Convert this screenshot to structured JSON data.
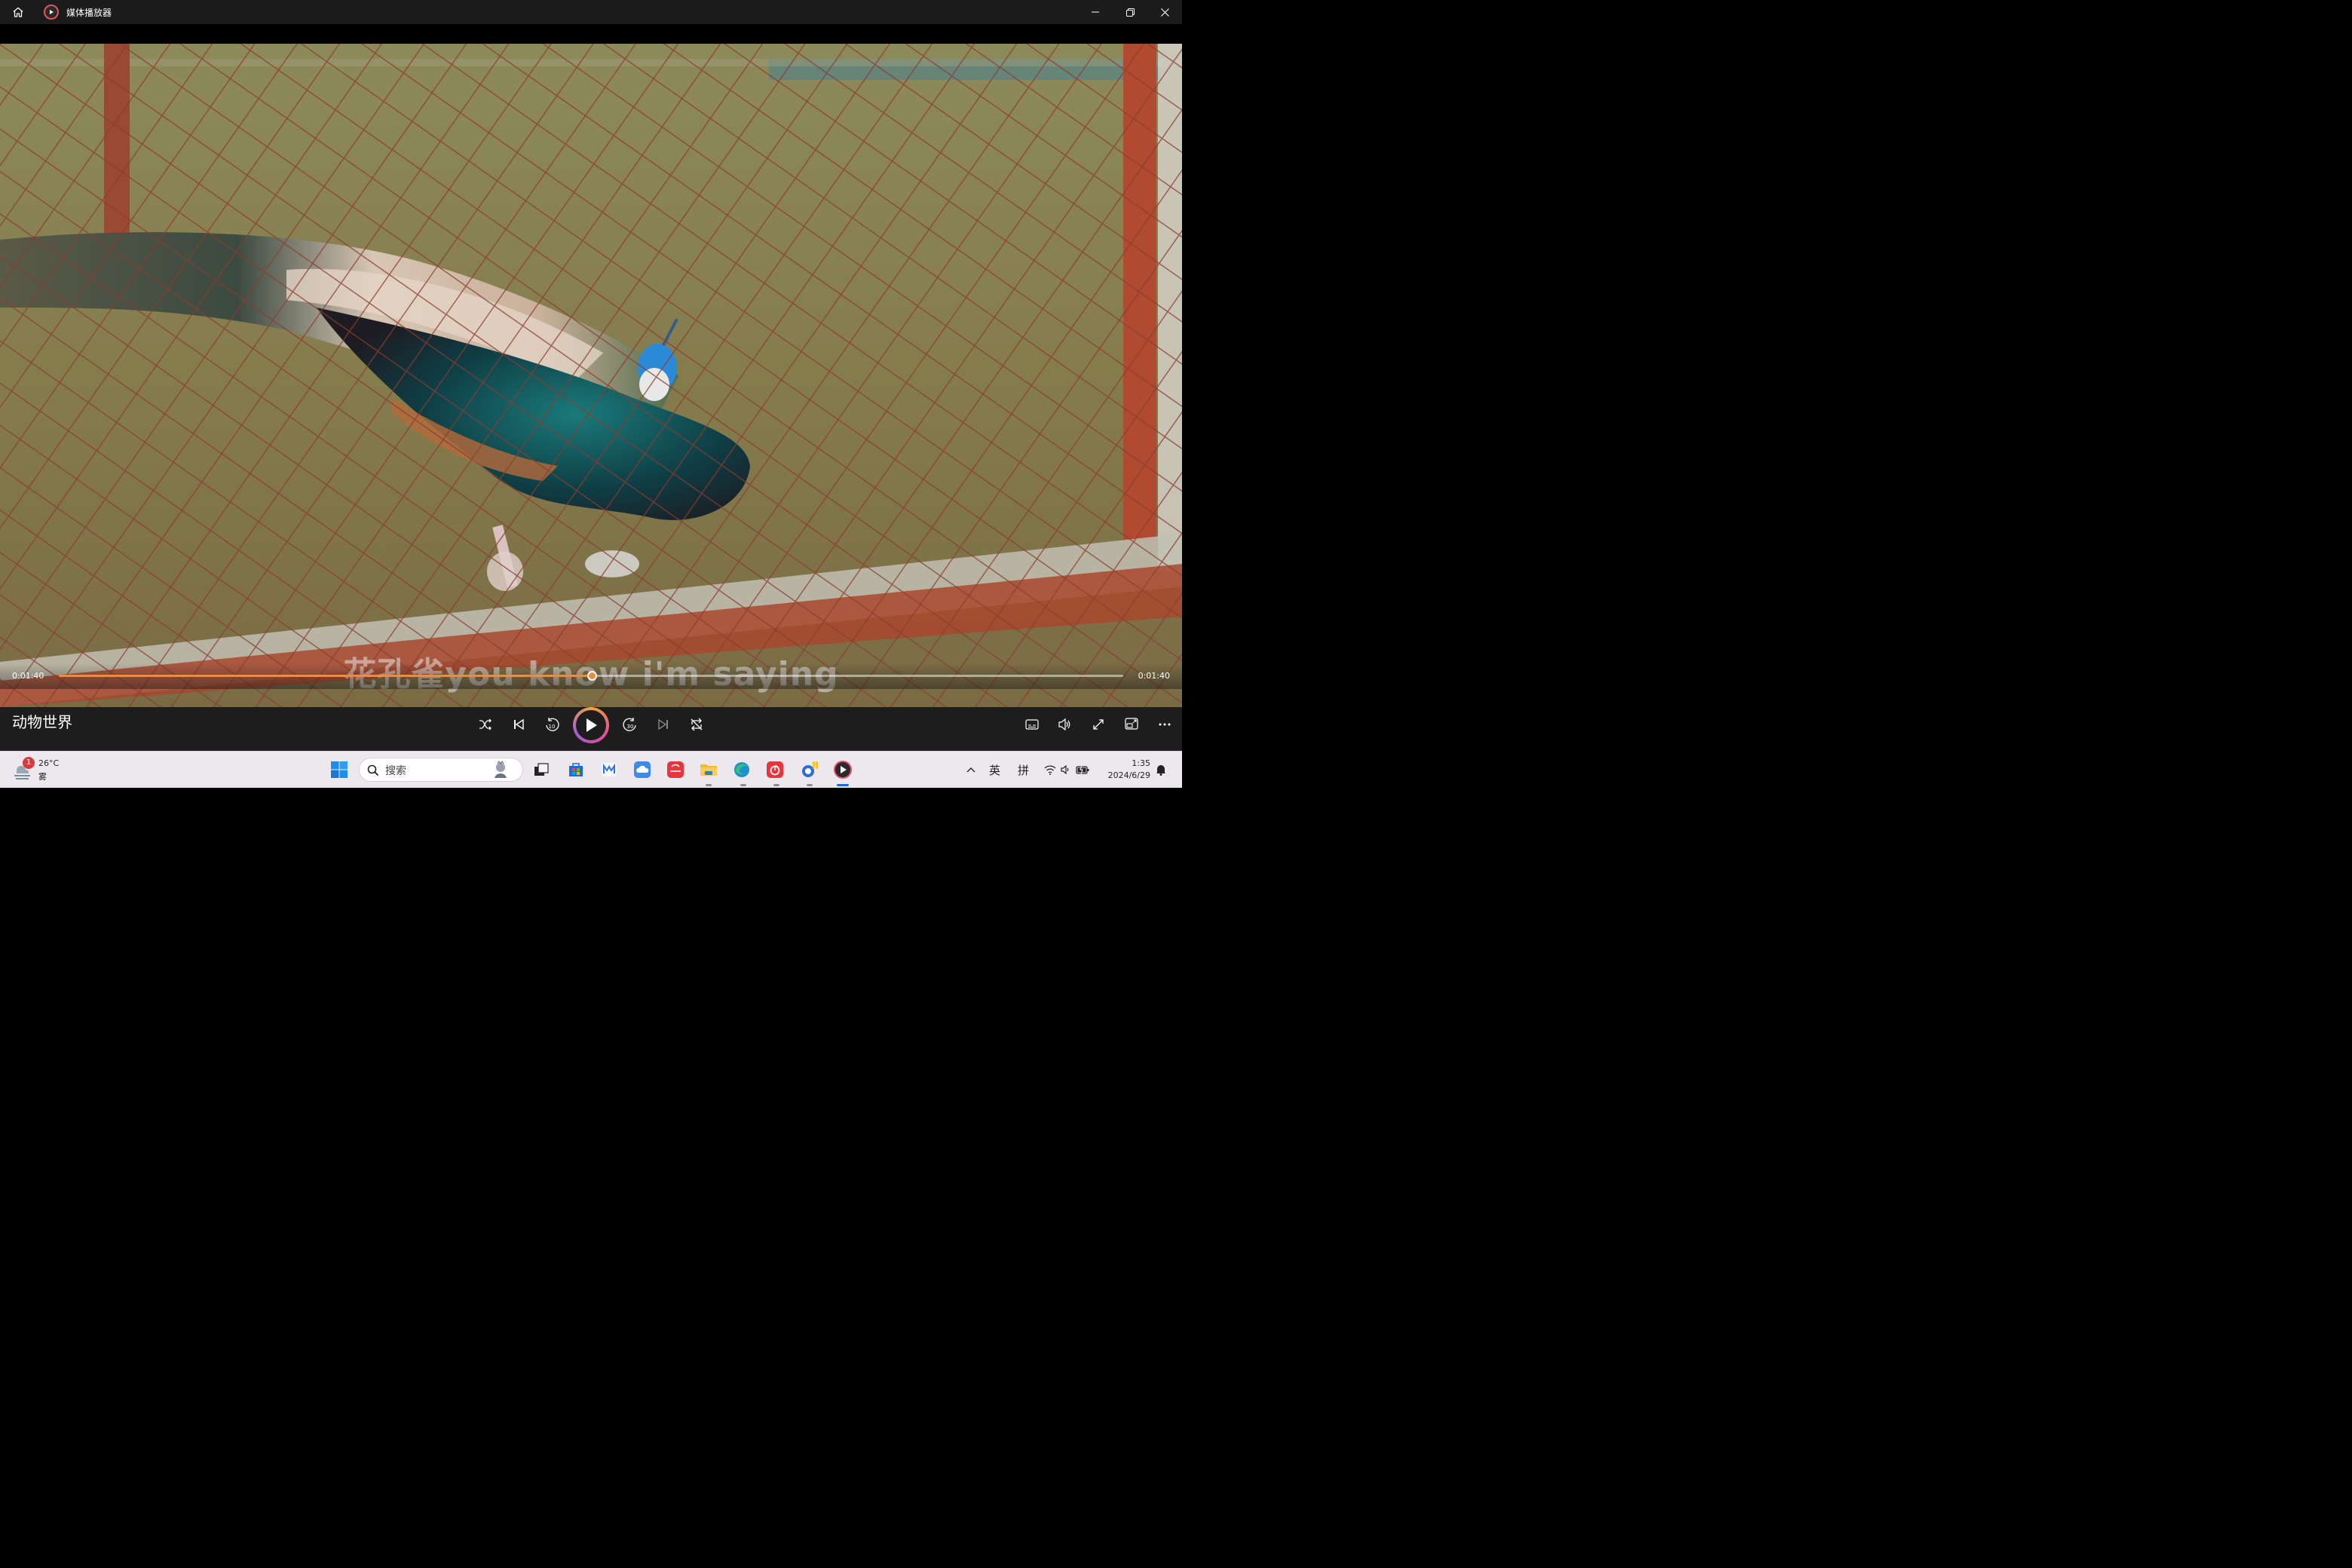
{
  "window": {
    "title": "媒体播放器"
  },
  "player": {
    "subtitle": "花孔雀you know i'm saying",
    "time_elapsed": "0:01:40",
    "time_total": "0:01:40",
    "progress": 0.501,
    "accent_color": "#f08a3c",
    "media_title": "动物世界"
  },
  "controls": {
    "icons": [
      "shuffle-icon",
      "previous-icon",
      "skip-back-10-icon",
      "play-icon",
      "skip-forward-30-icon",
      "next-icon",
      "repeat-icon",
      "captions-icon",
      "volume-icon",
      "fullscreen-icon",
      "miniplayer-icon",
      "more-icon"
    ],
    "skip_back_label": "10",
    "skip_forward_label": "30"
  },
  "taskbar": {
    "weather_badge": "1",
    "weather_temp": "26°C",
    "weather_desc": "雾",
    "search_placeholder": "搜索",
    "ime_lang": "英",
    "ime_mode": "拼",
    "clock_time": "1:35",
    "clock_date": "2024/6/29"
  }
}
